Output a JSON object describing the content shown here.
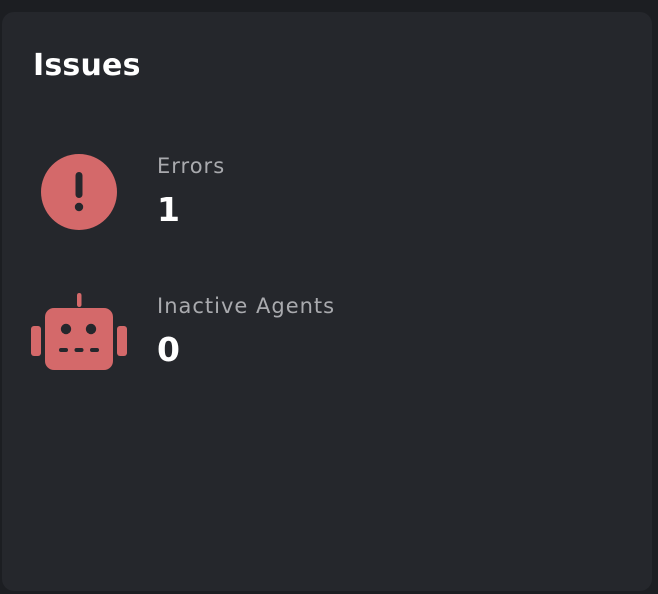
{
  "card": {
    "title": "Issues"
  },
  "issues": [
    {
      "label": "Errors",
      "value": "1",
      "icon": "error-circle-icon"
    },
    {
      "label": "Inactive Agents",
      "value": "0",
      "icon": "robot-icon"
    }
  ],
  "colors": {
    "background": "#1c1e22",
    "card": "#25272c",
    "icon_accent": "#d4696a",
    "label": "#a9aaae",
    "value": "#ffffff"
  }
}
